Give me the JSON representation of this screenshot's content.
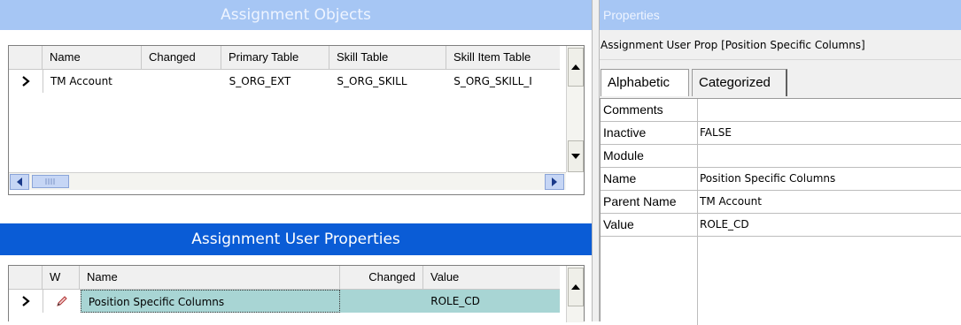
{
  "assignment_objects": {
    "title": "Assignment Objects",
    "columns": [
      "Name",
      "Changed",
      "Primary Table",
      "Skill Table",
      "Skill Item Table"
    ],
    "rows": [
      {
        "name": "TM Account",
        "changed": "",
        "primary_table": "S_ORG_EXT",
        "skill_table": "S_ORG_SKILL",
        "skill_item_table": "S_ORG_SKILL_I"
      }
    ]
  },
  "assignment_user_properties": {
    "title": "Assignment User Properties",
    "columns": [
      "W",
      "Name",
      "Changed",
      "Value"
    ],
    "rows": [
      {
        "w_icon": "pencil-icon",
        "name": "Position Specific Columns",
        "changed": "",
        "value": "ROLE_CD"
      }
    ]
  },
  "properties": {
    "title": "Properties",
    "subtitle": "Assignment User Prop [Position Specific Columns]",
    "tabs": [
      "Alphabetic",
      "Categorized"
    ],
    "active_tab": "Alphabetic",
    "rows": [
      {
        "name": "Comments",
        "value": ""
      },
      {
        "name": "Inactive",
        "value": "FALSE"
      },
      {
        "name": "Module",
        "value": ""
      },
      {
        "name": "Name",
        "value": "Position Specific Columns"
      },
      {
        "name": "Parent Name",
        "value": "TM Account"
      },
      {
        "name": "Value",
        "value": "ROLE_CD"
      }
    ]
  },
  "colors": {
    "inactive_title": "#a6c6f4",
    "active_title": "#0a5cd6",
    "selected_row": "#a8d5d4"
  }
}
